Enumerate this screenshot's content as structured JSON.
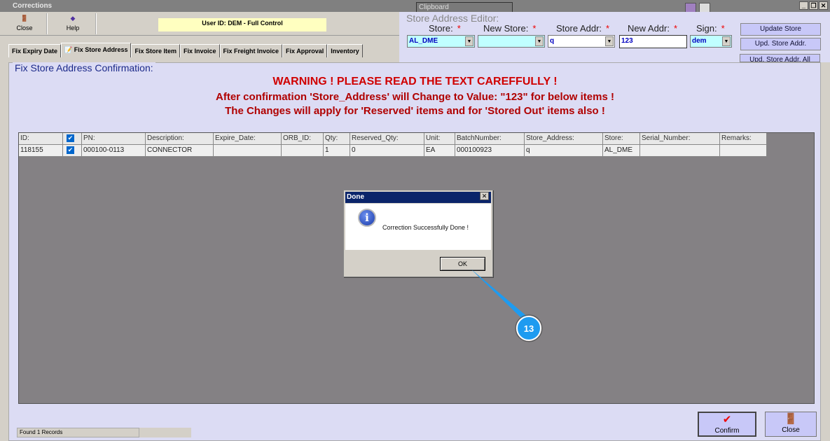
{
  "window": {
    "title": "Corrections",
    "clipboard": "Clipboard"
  },
  "toolbar": {
    "close": "Close",
    "help": "Help",
    "user": "User ID: DEM - Full Control"
  },
  "tabs": [
    "Fix Expiry Date",
    "Fix Store Address",
    "Fix Store Item",
    "Fix Invoice",
    "Fix Freight Invoice",
    "Fix Approval",
    "Inventory"
  ],
  "editor": {
    "title": "Store Address Editor:",
    "store_label": "Store:",
    "new_store_label": "New Store:",
    "store_addr_label": "Store Addr:",
    "new_addr_label": "New Addr:",
    "sign_label": "Sign:",
    "req": "*",
    "store": "AL_DME",
    "new_store": "",
    "store_addr": "q",
    "new_addr": "123",
    "sign": "dem",
    "update_store": "Update Store",
    "upd_addr": "Upd. Store Addr.",
    "upd_addr_all": "Upd. Store Addr. All"
  },
  "main": {
    "title": "Fix Store Address Confirmation:",
    "warn1": "WARNING ! PLEASE READ THE TEXT CAREFFULLY !",
    "warn2": "After confirmation 'Store_Address' will Change to Value: \"123\" for below items !",
    "warn3": "The Changes will apply for 'Reserved' items and for 'Stored Out' items also !"
  },
  "grid": {
    "headers": [
      "ID:",
      "",
      "PN:",
      "Description:",
      "Expire_Date:",
      "ORB_ID:",
      "Qty:",
      "Reserved_Qty:",
      "Unit:",
      "BatchNumber:",
      "Store_Address:",
      "Store:",
      "Serial_Number:",
      "Remarks:"
    ],
    "rows": [
      [
        "118155",
        "",
        "000100-0113",
        "CONNECTOR",
        "",
        "",
        "1",
        "0",
        "EA",
        "000100923",
        "q",
        "AL_DME",
        "",
        ""
      ]
    ]
  },
  "dialog": {
    "title": "Done",
    "message": "Correction Successfully Done !",
    "ok": "OK"
  },
  "callout": {
    "number": "13",
    "color": "#1e9bf0"
  },
  "status": "Found 1 Records",
  "footer": {
    "confirm": "Confirm",
    "close": "Close"
  }
}
